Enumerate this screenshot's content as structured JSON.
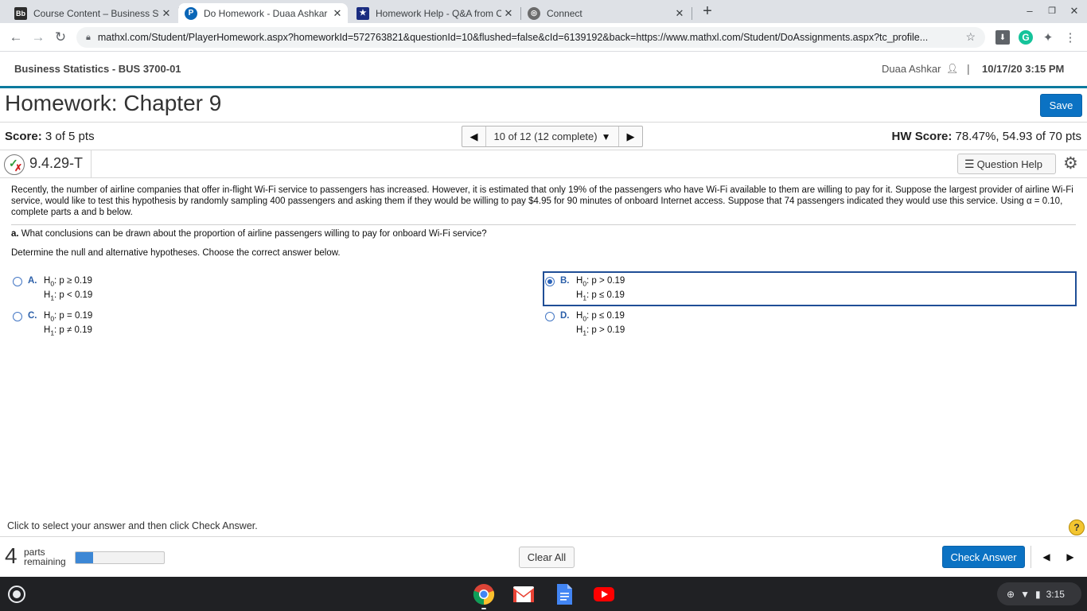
{
  "browser": {
    "tabs": [
      {
        "label": "Course Content – Business Stati",
        "favicon": "Bb",
        "active": false
      },
      {
        "label": "Do Homework - Duaa Ashkar",
        "favicon": "pearson-icon",
        "active": true
      },
      {
        "label": "Homework Help - Q&A from Onli",
        "favicon": "star-shield-icon",
        "active": false
      },
      {
        "label": "Connect",
        "favicon": "globe-icon",
        "active": false
      }
    ],
    "url": "mathxl.com/Student/PlayerHomework.aspx?homeworkId=572763821&questionId=10&flushed=false&cId=6139192&back=https://www.mathxl.com/Student/DoAssignments.aspx?tc_profile..."
  },
  "header": {
    "course": "Business Statistics - BUS 3700-01",
    "user": "Duaa Ashkar",
    "separator": "|",
    "datetime": "10/17/20 3:15 PM"
  },
  "homework": {
    "title": "Homework: Chapter 9",
    "save_label": "Save"
  },
  "score": {
    "label": "Score:",
    "value": "3 of 5 pts",
    "nav_text": "10 of 12 (12 complete)",
    "hw_label": "HW Score:",
    "hw_value": "78.47%, 54.93 of 70 pts"
  },
  "question": {
    "number": "9.4.29-T",
    "help_label": "Question Help",
    "problem_text": "Recently, the number of airline companies that offer in-flight Wi-Fi service to passengers has increased. However, it is estimated that only 19% of the passengers who have Wi-Fi available to them are willing to pay for it. Suppose the largest provider of airline Wi-Fi service, would like to test this hypothesis by randomly sampling 400 passengers and asking them if they would be willing to pay $4.95 for 90 minutes of onboard Internet access. Suppose that 74 passengers indicated they would use this service. Using α = 0.10, complete parts a and b below.",
    "part_label": "a.",
    "part_text": "What conclusions can be drawn about the proportion of airline passengers willing to pay for onboard Wi-Fi service?",
    "instruction": "Determine the null and alternative hypotheses. Choose the correct answer below.",
    "choices": [
      {
        "letter": "A.",
        "h0_rel": ": p ≥ 0.19",
        "h1_rel": ": p < 0.19",
        "selected": false
      },
      {
        "letter": "B.",
        "h0_rel": ": p > 0.19",
        "h1_rel": ": p ≤ 0.19",
        "selected": true
      },
      {
        "letter": "C.",
        "h0_rel": ": p = 0.19",
        "h1_rel": ": p ≠ 0.19",
        "selected": false
      },
      {
        "letter": "D.",
        "h0_rel": ": p ≤ 0.19",
        "h1_rel": ": p > 0.19",
        "selected": false
      }
    ],
    "h0_symbol": "H",
    "h0_sub": "0",
    "h1_symbol": "H",
    "h1_sub": "1"
  },
  "footer": {
    "hint": "Click to select your answer and then click Check Answer.",
    "parts_count": "4",
    "parts_line1": "parts",
    "parts_line2": "remaining",
    "progress_fraction": 0.2,
    "clear_label": "Clear All",
    "check_label": "Check Answer"
  },
  "shelf": {
    "time": "3:15",
    "apps": [
      "chrome-icon",
      "gmail-icon",
      "docs-icon",
      "youtube-icon"
    ]
  },
  "colors": {
    "accent": "#0b72c3",
    "header_rule": "#0b7a9e",
    "selected_frame": "#1f4e96"
  }
}
